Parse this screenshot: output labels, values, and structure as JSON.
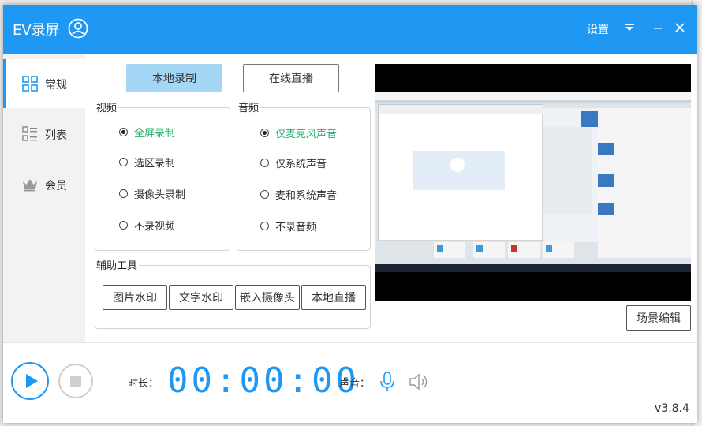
{
  "app": {
    "title": "EV录屏",
    "settings_label": "设置",
    "version": "v3.8.4"
  },
  "sidebar": {
    "items": [
      {
        "label": "常规"
      },
      {
        "label": "列表"
      },
      {
        "label": "会员"
      }
    ]
  },
  "mode_buttons": {
    "local": "本地录制",
    "live": "在线直播"
  },
  "video": {
    "title": "视频",
    "options": [
      {
        "label": "全屏录制"
      },
      {
        "label": "选区录制"
      },
      {
        "label": "摄像头录制"
      },
      {
        "label": "不录视频"
      }
    ],
    "selected": 0
  },
  "audio": {
    "title": "音频",
    "options": [
      {
        "label": "仅麦克风声音"
      },
      {
        "label": "仅系统声音"
      },
      {
        "label": "麦和系统声音"
      },
      {
        "label": "不录音频"
      }
    ],
    "selected": 0
  },
  "tools": {
    "title": "辅助工具",
    "buttons": [
      {
        "label": "图片水印"
      },
      {
        "label": "文字水印"
      },
      {
        "label": "嵌入摄像头"
      },
      {
        "label": "本地直播"
      }
    ]
  },
  "scene_edit_label": "场景编辑",
  "bottom": {
    "duration_label": "时长：",
    "timer": "00:00:00",
    "sound_label": "声音："
  },
  "colors": {
    "accent": "#1f98f4",
    "selected_option": "#22b26d",
    "primary_button": "#a4d6f6"
  }
}
